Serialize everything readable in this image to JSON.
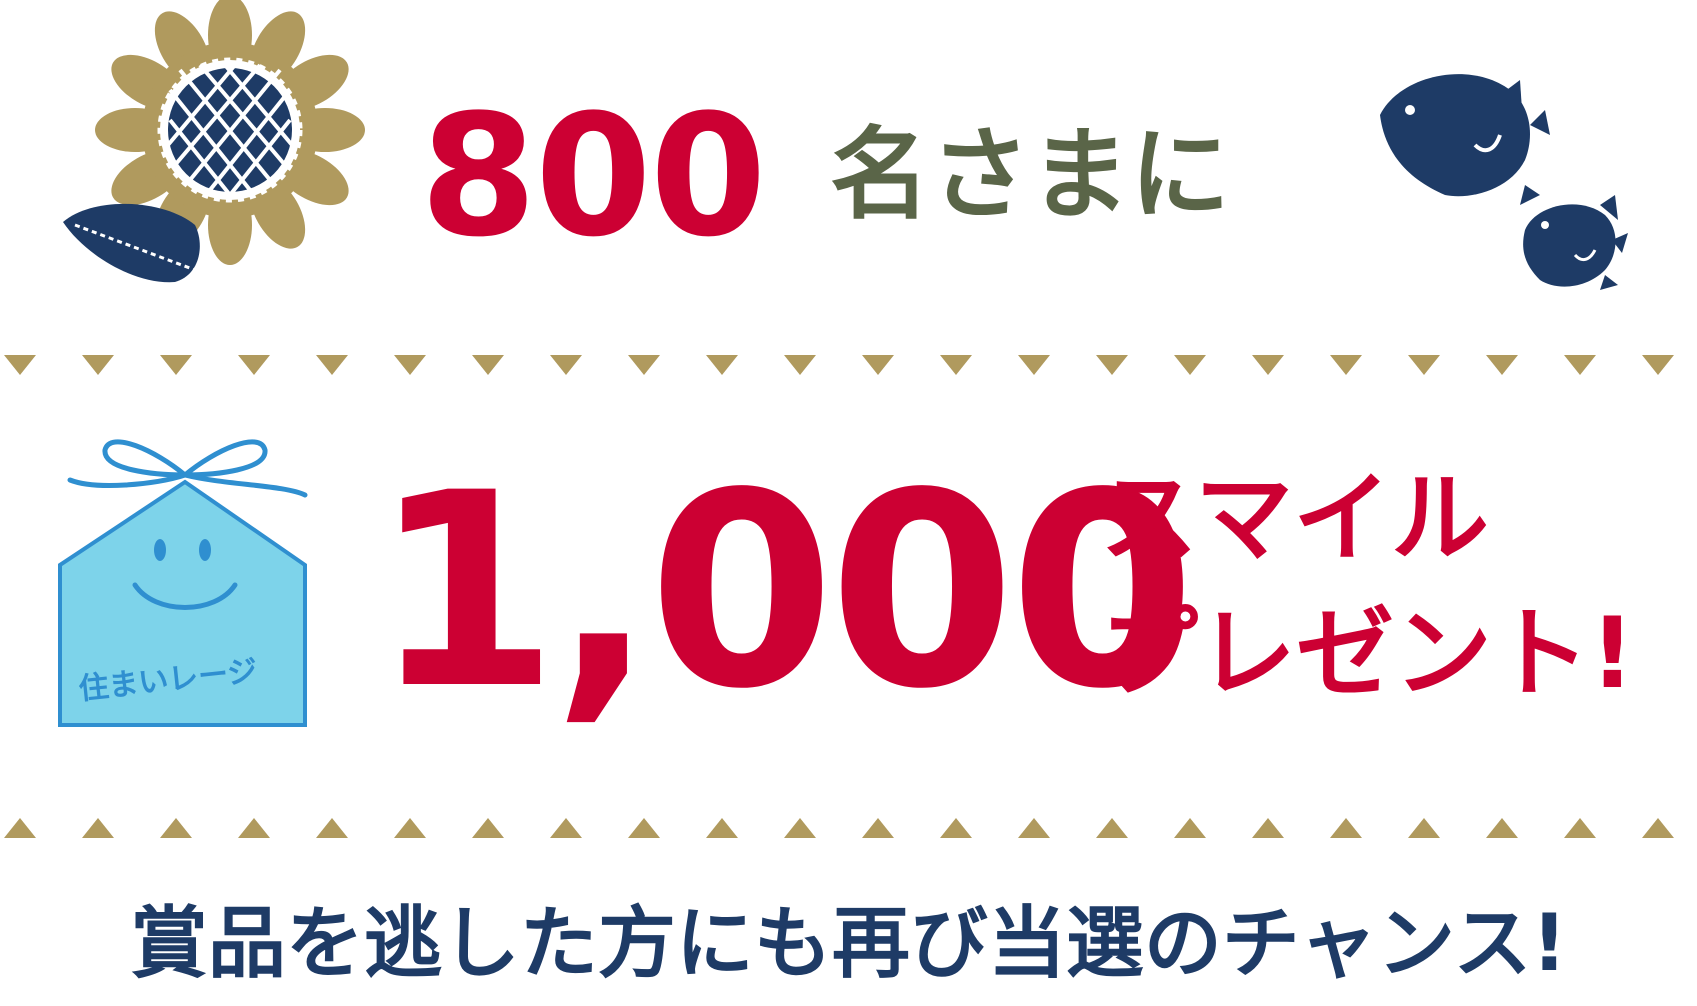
{
  "top": {
    "count": "800",
    "suffix": "名さまに"
  },
  "middle": {
    "amount": "1,000",
    "line1": "スマイル",
    "line2": "プレゼント!",
    "tag_label": "住まいレージ"
  },
  "bottom": {
    "message": "賞品を逃した方にも再び当選のチャンス!"
  },
  "colors": {
    "red": "#cc0033",
    "olive": "#5a6548",
    "navy": "#1e3b66",
    "gold": "#b09a5e",
    "sky": "#7dd3ea"
  },
  "icons": [
    "sunflower-icon",
    "birds-icon",
    "gift-tag-icon"
  ]
}
